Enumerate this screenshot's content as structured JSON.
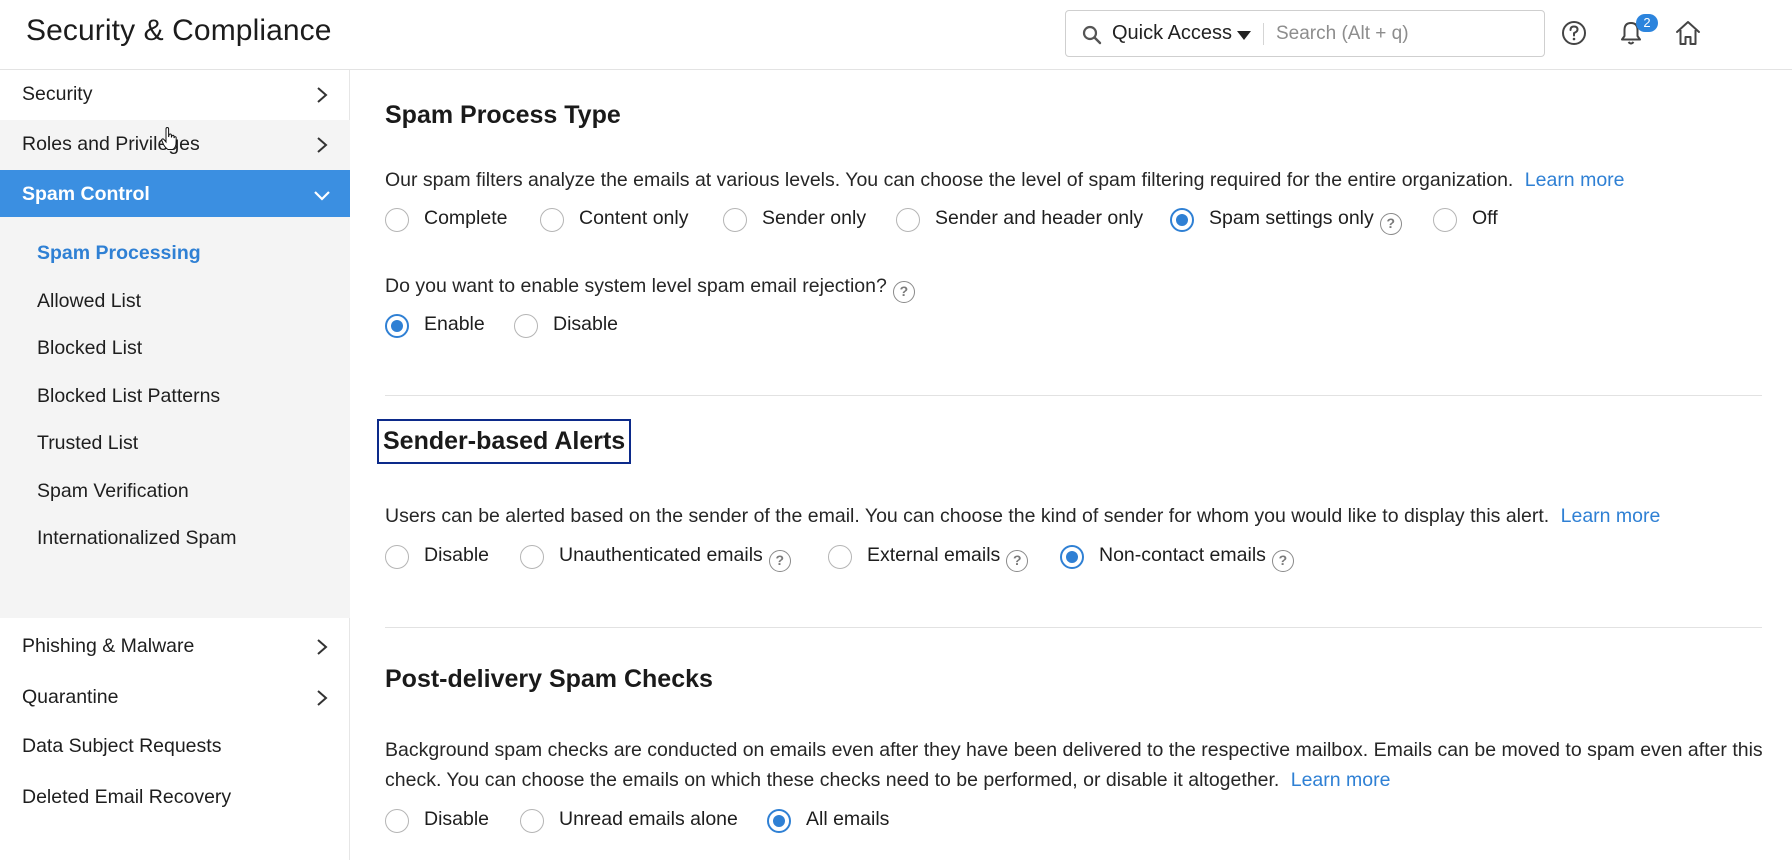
{
  "header": {
    "title": "Security & Compliance",
    "quick_access": "Quick Access",
    "search_placeholder": "Search (Alt + q)",
    "notification_count": "2"
  },
  "sidebar": {
    "items": [
      {
        "label": "Security"
      },
      {
        "label": "Roles and Privileges"
      },
      {
        "label": "Spam Control"
      },
      {
        "label": "Phishing & Malware"
      },
      {
        "label": "Quarantine"
      },
      {
        "label": "Data Subject Requests"
      },
      {
        "label": "Deleted Email Recovery"
      }
    ],
    "spam_sub": [
      {
        "label": "Spam Processing"
      },
      {
        "label": "Allowed List"
      },
      {
        "label": "Blocked List"
      },
      {
        "label": "Blocked List Patterns"
      },
      {
        "label": "Trusted List"
      },
      {
        "label": "Spam Verification"
      },
      {
        "label": "Internationalized Spam"
      }
    ]
  },
  "main": {
    "spam_process": {
      "title": "Spam Process Type",
      "desc": "Our spam filters analyze the emails at various levels. You can choose the level of spam filtering required for the entire organization.",
      "link": "Learn more",
      "options": [
        "Complete",
        "Content only",
        "Sender only",
        "Sender and header only",
        "Spam settings only",
        "Off"
      ],
      "selected": "Spam settings only",
      "rejection_question": "Do you want to enable system level spam email rejection?",
      "rejection_options": [
        "Enable",
        "Disable"
      ],
      "rejection_selected": "Enable"
    },
    "sender_alerts": {
      "title": "Sender-based Alerts",
      "desc": "Users can be alerted based on the sender of the email. You can choose the kind of sender for whom you would like to display this alert.",
      "link": "Learn more",
      "options": [
        "Disable",
        "Unauthenticated emails",
        "External emails",
        "Non-contact emails"
      ],
      "selected": "Non-contact emails"
    },
    "post_delivery": {
      "title": "Post-delivery Spam Checks",
      "desc": "Background spam checks are conducted on emails even after they have been delivered to the respective mailbox. Emails can be moved to spam even after this check. You can choose the emails on which these checks need to be performed, or disable it altogether.",
      "link": "Learn more",
      "options": [
        "Disable",
        "Unread emails alone",
        "All emails"
      ],
      "selected": "All emails"
    },
    "help_glyph": "?"
  },
  "colors": {
    "accent": "#2f80d4",
    "active_nav": "#3b8fe1",
    "focus_outline": "#0c2a8a"
  }
}
